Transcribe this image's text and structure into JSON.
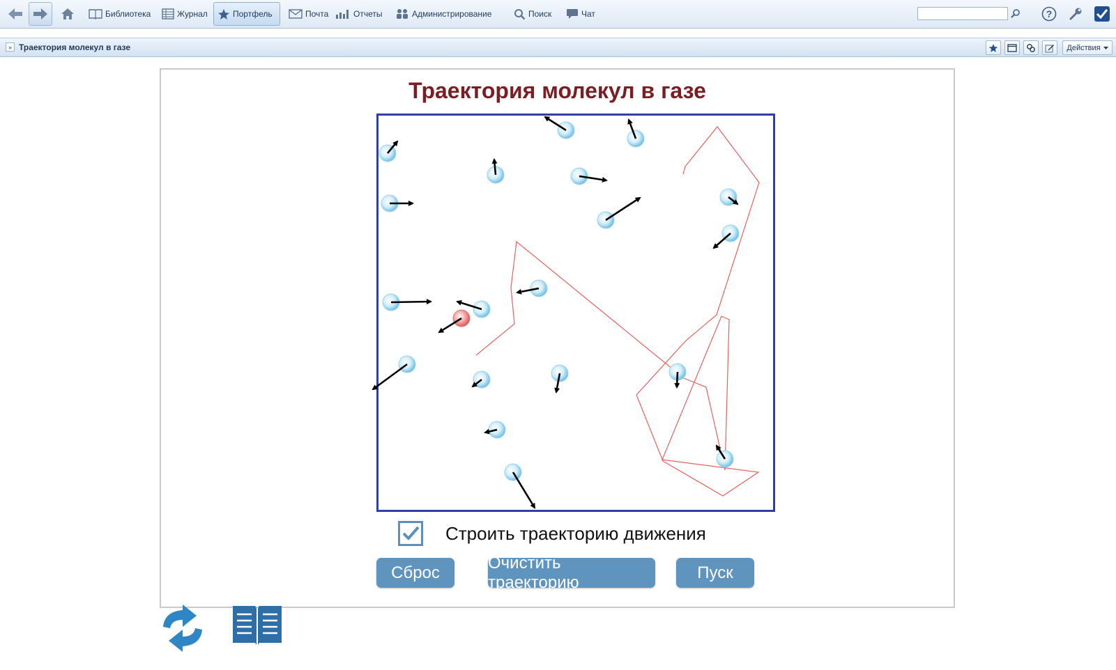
{
  "toolbar": {
    "items": [
      {
        "label": "Библиотека",
        "icon": "book-icon"
      },
      {
        "label": "Журнал",
        "icon": "journal-icon"
      },
      {
        "label": "Портфель",
        "icon": "star-icon",
        "active": true
      },
      {
        "label": "Почта",
        "icon": "mail-icon"
      },
      {
        "label": "Отчеты",
        "icon": "chart-icon"
      },
      {
        "label": "Администрирование",
        "icon": "users-icon"
      },
      {
        "label": "Поиск",
        "icon": "search-icon"
      },
      {
        "label": "Чат",
        "icon": "chat-icon"
      }
    ],
    "search_value": ""
  },
  "breadcrumb": {
    "title": "Траектория молекул в газе",
    "actions_label": "Действия"
  },
  "simulation": {
    "title": "Траектория молекул в газе",
    "checkbox_label": "Строить траекторию движения",
    "checkbox_checked": true,
    "buttons": {
      "reset": "Сброс",
      "clear": "Очистить траекторию",
      "start": "Пуск"
    }
  },
  "colors": {
    "title": "#7a1e24",
    "box_border": "#2f3ea8",
    "button": "#5f94bf",
    "trajectory": "#e8605c",
    "tracked_molecule": "#e86a6a",
    "molecule": "#8ccfee"
  }
}
